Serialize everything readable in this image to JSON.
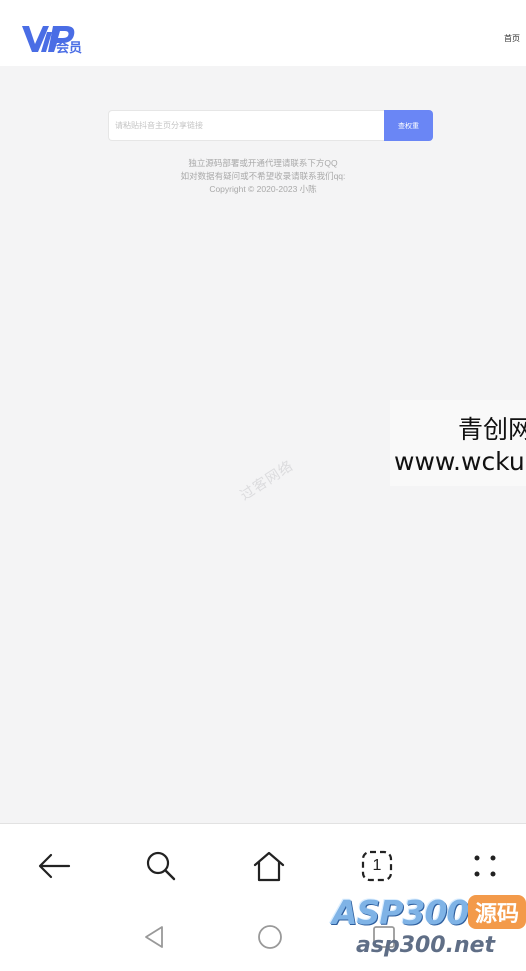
{
  "header": {
    "logo": {
      "text": "VIP",
      "sub": "会员",
      "color": "#4a6de5"
    },
    "nav_home": "首页"
  },
  "search": {
    "placeholder": "请粘贴抖音主页分享链接",
    "value": "",
    "button_label": "查权重",
    "accent": "#6a86f5"
  },
  "footer": {
    "line1": "独立源码部署或开通代理请联系下方QQ",
    "line2": "如对数据有疑问或不希望收录请联系我们qq:",
    "line3": "Copyright © 2020-2023 小陈"
  },
  "watermark": "过客网络",
  "overlay": {
    "line1": "青创网",
    "line2": "www.wcku"
  },
  "browser_bar": {
    "icons": [
      "back-arrow-icon",
      "search-icon",
      "home-icon",
      "tabs-icon",
      "menu-dots-icon"
    ],
    "tab_count": "1"
  },
  "system_nav": {
    "icons": [
      "back-triangle-icon",
      "home-circle-icon",
      "recents-square-icon"
    ]
  },
  "asp_logo": {
    "main": "ASP300",
    "badge": "源码",
    "sub": "asp300.net"
  }
}
